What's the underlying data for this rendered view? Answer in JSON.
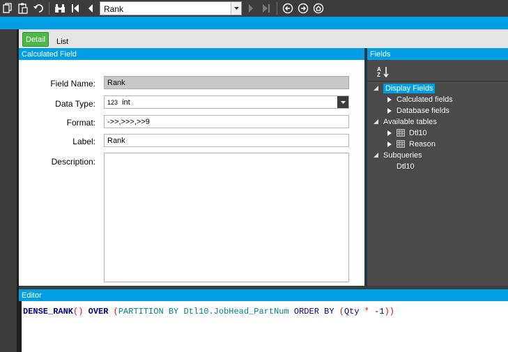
{
  "toolbar": {
    "icons": [
      "copy-icon",
      "paste-icon",
      "undo-icon",
      "binoculars-icon",
      "first-icon",
      "previous-icon",
      "next-icon",
      "last-icon",
      "back-icon",
      "forward-icon",
      "home-icon"
    ],
    "combo_value": "Rank"
  },
  "tabs": [
    {
      "label": "Detail",
      "active": true
    },
    {
      "label": "List",
      "active": false
    }
  ],
  "calculated_field": {
    "title": "Calculated Field",
    "field_name_label": "Field Name:",
    "field_name_value": "Rank",
    "data_type_label": "Data Type:",
    "data_type_prefix": "123",
    "data_type_value": "int",
    "format_label": "Format:",
    "format_value": "->>,>>>,>>9",
    "label_label": "Label:",
    "label_value": "Rank",
    "description_label": "Description:",
    "description_value": ""
  },
  "fields": {
    "title": "Fields",
    "sort_label": "AZ",
    "tree": [
      {
        "label": "Display Fields",
        "level": 0,
        "expanded": true,
        "selected": true
      },
      {
        "label": "Calculated fields",
        "level": 1,
        "expanded": false
      },
      {
        "label": "Database fields",
        "level": 1,
        "expanded": false
      },
      {
        "label": "Available tables",
        "level": 0,
        "expanded": true
      },
      {
        "label": "Dtl10",
        "level": 1,
        "expanded": false,
        "table": true
      },
      {
        "label": "Reason",
        "level": 1,
        "expanded": false,
        "table": true
      },
      {
        "label": "Subqueries",
        "level": 0,
        "expanded": true
      },
      {
        "label": "Dtl10",
        "level": 1,
        "leaf": true
      }
    ]
  },
  "editor": {
    "title": "Editor",
    "code_tokens": [
      "DENSE_RANK",
      "()",
      " ",
      "OVER",
      " ",
      "(",
      "PARTITION",
      " ",
      "BY",
      " ",
      "Dtl10.JobHead_PartNum",
      " ",
      "ORDER",
      " ",
      "BY",
      " ",
      "(",
      "Qty",
      " ",
      "*",
      " ",
      "-1",
      "))"
    ]
  },
  "colors": {
    "accent": "#009fe3",
    "tab_active": "#4db848",
    "dark": "#3c3c3c"
  }
}
